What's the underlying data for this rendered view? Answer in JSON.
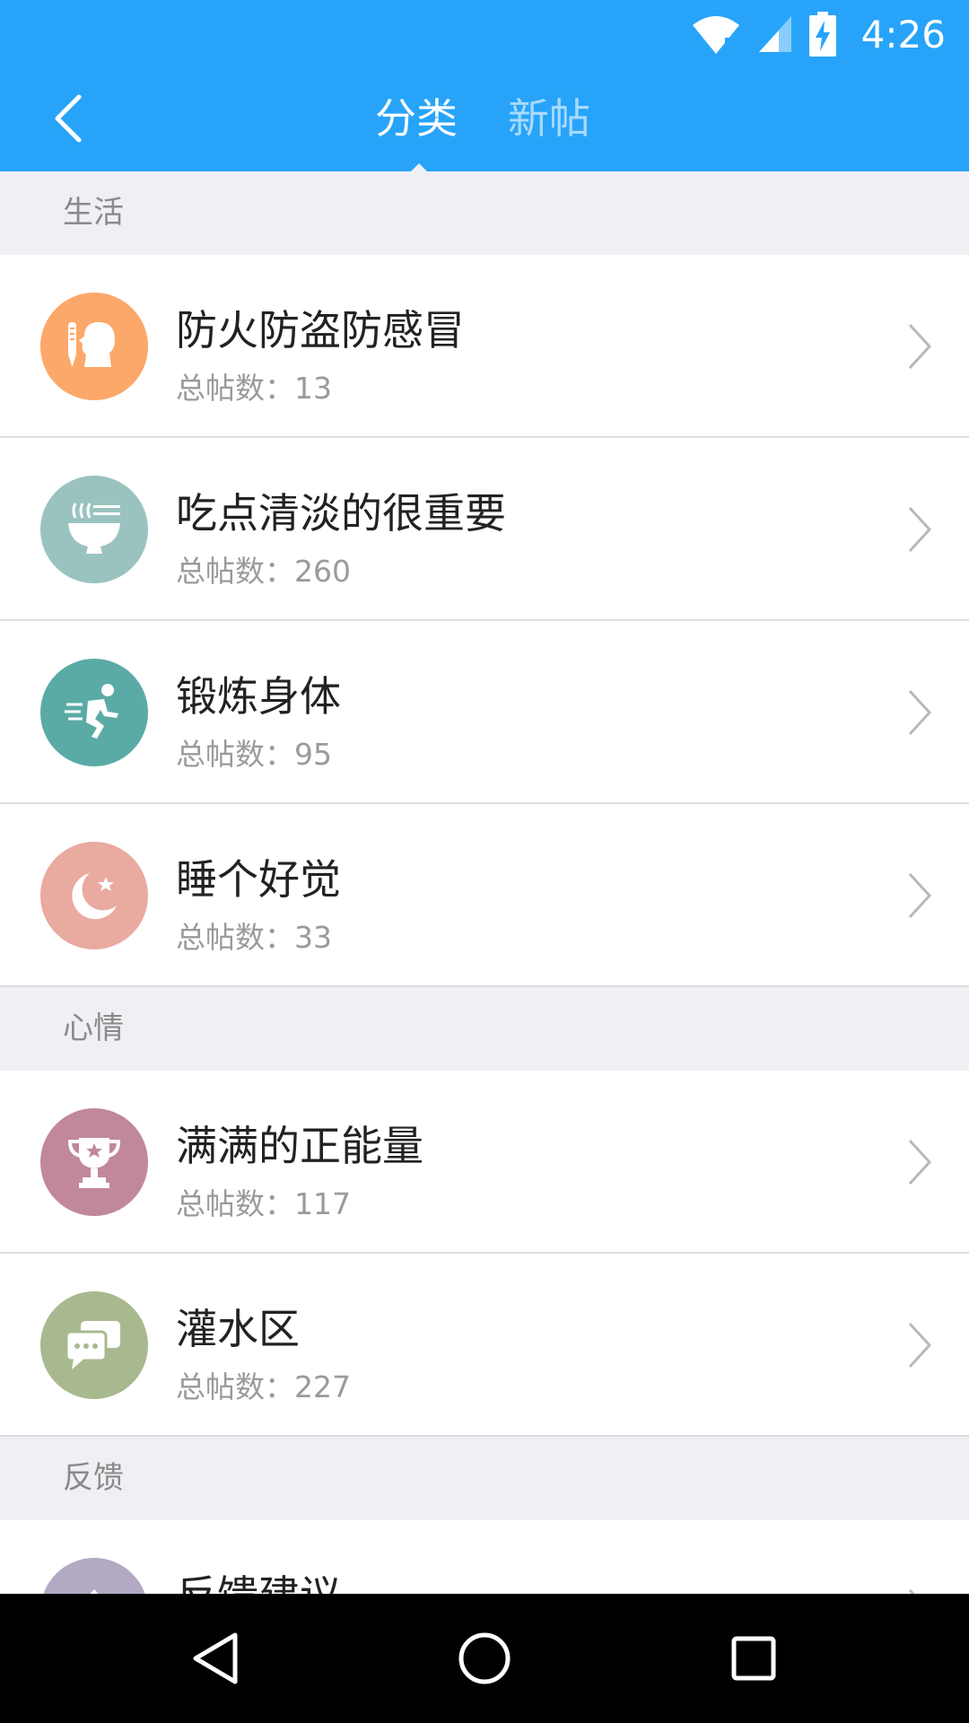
{
  "status_bar": {
    "time": "4:26"
  },
  "header": {
    "tabs": [
      {
        "label": "分类",
        "active": true
      },
      {
        "label": "新帖",
        "active": false
      }
    ]
  },
  "count_prefix": "总帖数：",
  "sections": [
    {
      "title": "生活",
      "items": [
        {
          "title": "防火防盗防感冒",
          "count": "13",
          "icon": "thermometer-person-icon",
          "color": "#fca86a"
        },
        {
          "title": "吃点清淡的很重要",
          "count": "260",
          "icon": "noodle-bowl-icon",
          "color": "#9ac3bf"
        },
        {
          "title": "锻炼身体",
          "count": "95",
          "icon": "running-person-icon",
          "color": "#5aaba5"
        },
        {
          "title": "睡个好觉",
          "count": "33",
          "icon": "moon-star-icon",
          "color": "#e9aaa0"
        }
      ]
    },
    {
      "title": "心情",
      "items": [
        {
          "title": "满满的正能量",
          "count": "117",
          "icon": "trophy-icon",
          "color": "#c0879d"
        },
        {
          "title": "灌水区",
          "count": "227",
          "icon": "chat-bubbles-icon",
          "color": "#a9b98f"
        }
      ]
    },
    {
      "title": "反馈",
      "items": [
        {
          "title": "反馈建议",
          "count": "",
          "icon": "feedback-icon",
          "color": "#b3a9c4"
        }
      ]
    }
  ],
  "colors": {
    "primary": "#27a4f9",
    "section_bg": "#efeff4",
    "nav_bg": "#000000"
  }
}
